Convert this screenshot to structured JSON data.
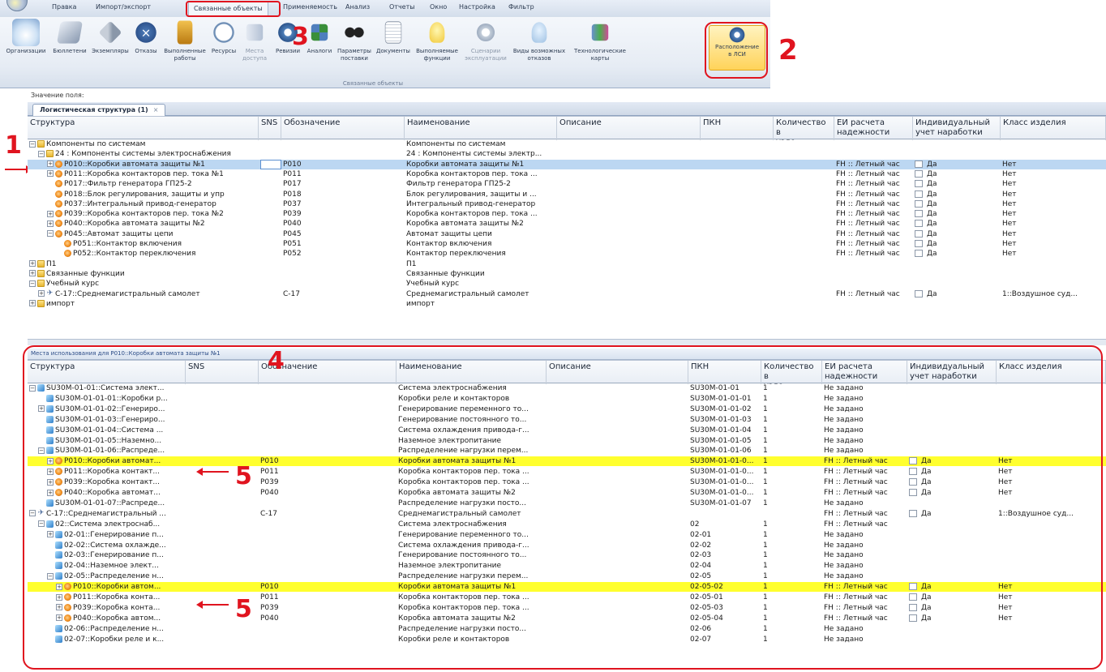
{
  "menu": {
    "tabs": [
      "Правка",
      "Импорт/экспорт",
      "Связанные объекты",
      "Применяемость",
      "Анализ",
      "Отчеты",
      "Окно",
      "Настройка",
      "Фильтр"
    ],
    "active_tab": "Связанные объекты"
  },
  "ribbon": {
    "buttons": [
      {
        "label": "Организации",
        "icon": "house-icon"
      },
      {
        "label": "Бюллетени",
        "icon": "bulletin-icon"
      },
      {
        "label": "Экземпляры",
        "icon": "wrench-icon"
      },
      {
        "label": "Отказы",
        "icon": "failure-icon"
      },
      {
        "label": "Выполненные\nработы",
        "icon": "tool-icon"
      },
      {
        "label": "Ресурсы",
        "icon": "clock-icon"
      },
      {
        "label": "Места\nдоступа",
        "icon": "access-icon"
      },
      {
        "label": "Ревизии",
        "icon": "gear-icon"
      },
      {
        "label": "Аналоги",
        "icon": "analog-icon"
      },
      {
        "label": "Параметры\nпоставки",
        "icon": "parameters-icon"
      },
      {
        "label": "Документы",
        "icon": "document-icon"
      },
      {
        "label": "Выполняемые\nфункции",
        "icon": "bulb-icon"
      },
      {
        "label": "Сценарии\nэксплуатации",
        "icon": "scenario-icon"
      },
      {
        "label": "Виды возможных\nотказов",
        "icon": "failure-kind-icon"
      },
      {
        "label": "Технологические\nкарты",
        "icon": "tech-card-icon"
      },
      {
        "label": "Расположение\nв ЛСИ",
        "icon": "location-gear-icon"
      }
    ],
    "group_label": "Связанные объекты"
  },
  "callouts": [
    "1",
    "2",
    "3",
    "4",
    "5",
    "5"
  ],
  "field_bar": "Значение поля:",
  "doc_tab": {
    "label": "Логистическая структура (1)",
    "close": "×"
  },
  "upper_grid": {
    "headers": [
      "Структура",
      "SNS",
      "Обозначение",
      "Наименование",
      "Описание",
      "ПКН",
      "Количество в\nузле",
      "ЕИ расчета\nнадежности",
      "Индивидуальный\nучет наработки",
      "Класс изделия"
    ],
    "rows": [
      {
        "level": 0,
        "exp": "−",
        "icon": "folder",
        "structure": "Компоненты по системам",
        "sns": "",
        "code": "",
        "name": "Компоненты по системам",
        "desc": "",
        "pkn": "",
        "qty": "",
        "ei": "",
        "ind": "",
        "cls": ""
      },
      {
        "level": 1,
        "exp": "−",
        "icon": "folder",
        "structure": "24 : Компоненты системы электроснабжения",
        "sns": "",
        "code": "",
        "name": "24 : Компоненты системы электр...",
        "desc": "",
        "pkn": "",
        "qty": "",
        "ei": "",
        "ind": "",
        "cls": ""
      },
      {
        "level": 2,
        "exp": "+",
        "icon": "comp",
        "structure": "P010::Коробки автомата защиты №1",
        "sns": "",
        "code": "P010",
        "name": "Коробки автомата защиты №1",
        "desc": "",
        "pkn": "",
        "qty": "",
        "ei": "FH :: Летный час",
        "ind": "Да",
        "cls": "Нет",
        "state": "selected"
      },
      {
        "level": 2,
        "exp": "+",
        "icon": "comp",
        "structure": "P011::Коробка контакторов пер. тока №1",
        "sns": "",
        "code": "P011",
        "name": "Коробка контакторов пер. тока ...",
        "desc": "",
        "pkn": "",
        "qty": "",
        "ei": "FH :: Летный час",
        "ind": "Да",
        "cls": "Нет"
      },
      {
        "level": 2,
        "exp": "",
        "icon": "comp",
        "structure": "P017::Фильтр генератора ГП25-2",
        "sns": "",
        "code": "P017",
        "name": "Фильтр генератора ГП25-2",
        "desc": "",
        "pkn": "",
        "qty": "",
        "ei": "FH :: Летный час",
        "ind": "Да",
        "cls": "Нет"
      },
      {
        "level": 2,
        "exp": "",
        "icon": "comp",
        "structure": "P018::Блок регулирования, защиты и упр",
        "sns": "",
        "code": "P018",
        "name": "Блок регулирования, защиты и ...",
        "desc": "",
        "pkn": "",
        "qty": "",
        "ei": "FH :: Летный час",
        "ind": "Да",
        "cls": "Нет"
      },
      {
        "level": 2,
        "exp": "",
        "icon": "comp",
        "structure": "P037::Интегральный привод-генератор",
        "sns": "",
        "code": "P037",
        "name": "Интегральный привод-генератор",
        "desc": "",
        "pkn": "",
        "qty": "",
        "ei": "FH :: Летный час",
        "ind": "Да",
        "cls": "Нет"
      },
      {
        "level": 2,
        "exp": "+",
        "icon": "comp",
        "structure": "P039::Коробка контакторов пер. тока №2",
        "sns": "",
        "code": "P039",
        "name": "Коробка контакторов пер. тока ...",
        "desc": "",
        "pkn": "",
        "qty": "",
        "ei": "FH :: Летный час",
        "ind": "Да",
        "cls": "Нет"
      },
      {
        "level": 2,
        "exp": "+",
        "icon": "comp",
        "structure": "P040::Коробка автомата защиты №2",
        "sns": "",
        "code": "P040",
        "name": "Коробка автомата защиты №2",
        "desc": "",
        "pkn": "",
        "qty": "",
        "ei": "FH :: Летный час",
        "ind": "Да",
        "cls": "Нет"
      },
      {
        "level": 2,
        "exp": "−",
        "icon": "comp",
        "structure": "P045::Автомат защиты цепи",
        "sns": "",
        "code": "P045",
        "name": "Автомат защиты цепи",
        "desc": "",
        "pkn": "",
        "qty": "",
        "ei": "FH :: Летный час",
        "ind": "Да",
        "cls": "Нет"
      },
      {
        "level": 3,
        "exp": "",
        "icon": "comp",
        "structure": "P051::Контактор включения",
        "sns": "",
        "code": "P051",
        "name": "Контактор включения",
        "desc": "",
        "pkn": "",
        "qty": "",
        "ei": "FH :: Летный час",
        "ind": "Да",
        "cls": "Нет"
      },
      {
        "level": 3,
        "exp": "",
        "icon": "comp",
        "structure": "P052::Контактор переключения",
        "sns": "",
        "code": "P052",
        "name": "Контактор переключения",
        "desc": "",
        "pkn": "",
        "qty": "",
        "ei": "FH :: Летный час",
        "ind": "Да",
        "cls": "Нет"
      },
      {
        "level": 0,
        "exp": "+",
        "icon": "folder",
        "structure": "П1",
        "sns": "",
        "code": "",
        "name": "П1",
        "desc": "",
        "pkn": "",
        "qty": "",
        "ei": "",
        "ind": "",
        "cls": ""
      },
      {
        "level": 0,
        "exp": "+",
        "icon": "folder",
        "structure": "Связанные функции",
        "sns": "",
        "code": "",
        "name": "Связанные функции",
        "desc": "",
        "pkn": "",
        "qty": "",
        "ei": "",
        "ind": "",
        "cls": ""
      },
      {
        "level": 0,
        "exp": "−",
        "icon": "folder",
        "structure": "Учебный курс",
        "sns": "",
        "code": "",
        "name": "Учебный курс",
        "desc": "",
        "pkn": "",
        "qty": "",
        "ei": "",
        "ind": "",
        "cls": ""
      },
      {
        "level": 1,
        "exp": "+",
        "icon": "plane",
        "structure": "С-17::Среднемагистральный самолет",
        "sns": "",
        "code": "С-17",
        "name": "Среднемагистральный самолет",
        "desc": "",
        "pkn": "",
        "qty": "",
        "ei": "FH :: Летный час",
        "ind": "Да",
        "cls": "1::Воздушное суд..."
      },
      {
        "level": 0,
        "exp": "+",
        "icon": "folder",
        "structure": "импорт",
        "sns": "",
        "code": "",
        "name": "импорт",
        "desc": "",
        "pkn": "",
        "qty": "",
        "ei": "",
        "ind": "",
        "cls": ""
      }
    ]
  },
  "lower_panel": {
    "title": "Места использования для P010::Коробки автомата защиты №1"
  },
  "lower_grid": {
    "headers": [
      "Структура",
      "SNS",
      "Обозначение",
      "Наименование",
      "Описание",
      "ПКН",
      "Количество в\nузле",
      "ЕИ расчета\nнадежности",
      "Индивидуальный\nучет наработки",
      "Класс изделия"
    ],
    "rows": [
      {
        "level": 0,
        "exp": "−",
        "icon": "node",
        "structure": "SU30M-01-01::Система элект...",
        "sns": "",
        "code": "",
        "name": "Система электроснабжения",
        "desc": "",
        "pkn": "SU30M-01-01",
        "qty": "1",
        "ei": "Не задано",
        "ind": "",
        "cls": ""
      },
      {
        "level": 1,
        "exp": "",
        "icon": "node",
        "structure": "SU30M-01-01-01::Коробки р...",
        "sns": "",
        "code": "",
        "name": "Коробки реле и контакторов",
        "desc": "",
        "pkn": "SU30M-01-01-01",
        "qty": "1",
        "ei": "Не задано",
        "ind": "",
        "cls": ""
      },
      {
        "level": 1,
        "exp": "+",
        "icon": "node",
        "structure": "SU30M-01-01-02::Генериро...",
        "sns": "",
        "code": "",
        "name": "Генерирование переменного то...",
        "desc": "",
        "pkn": "SU30M-01-01-02",
        "qty": "1",
        "ei": "Не задано",
        "ind": "",
        "cls": ""
      },
      {
        "level": 1,
        "exp": "",
        "icon": "node",
        "structure": "SU30M-01-01-03::Генериро...",
        "sns": "",
        "code": "",
        "name": "Генерирование постоянного то...",
        "desc": "",
        "pkn": "SU30M-01-01-03",
        "qty": "1",
        "ei": "Не задано",
        "ind": "",
        "cls": ""
      },
      {
        "level": 1,
        "exp": "",
        "icon": "node",
        "structure": "SU30M-01-01-04::Система ...",
        "sns": "",
        "code": "",
        "name": "Система охлаждения привода-г...",
        "desc": "",
        "pkn": "SU30M-01-01-04",
        "qty": "1",
        "ei": "Не задано",
        "ind": "",
        "cls": ""
      },
      {
        "level": 1,
        "exp": "",
        "icon": "node",
        "structure": "SU30M-01-01-05::Наземно...",
        "sns": "",
        "code": "",
        "name": "Наземное электропитание",
        "desc": "",
        "pkn": "SU30M-01-01-05",
        "qty": "1",
        "ei": "Не задано",
        "ind": "",
        "cls": ""
      },
      {
        "level": 1,
        "exp": "−",
        "icon": "node",
        "structure": "SU30M-01-01-06::Распреде...",
        "sns": "",
        "code": "",
        "name": "Распределение нагрузки перем...",
        "desc": "",
        "pkn": "SU30M-01-01-06",
        "qty": "1",
        "ei": "Не задано",
        "ind": "",
        "cls": ""
      },
      {
        "level": 2,
        "exp": "+",
        "icon": "comp",
        "structure": "P010::Коробки автомат...",
        "sns": "",
        "code": "P010",
        "name": "Коробки автомата защиты №1",
        "desc": "",
        "pkn": "SU30M-01-01-0...",
        "qty": "1",
        "ei": "FH :: Летный час",
        "ind": "Да",
        "cls": "Нет",
        "state": "hl"
      },
      {
        "level": 2,
        "exp": "+",
        "icon": "comp",
        "structure": "P011::Коробка контакт...",
        "sns": "",
        "code": "P011",
        "name": "Коробка контакторов пер. тока ...",
        "desc": "",
        "pkn": "SU30M-01-01-0...",
        "qty": "1",
        "ei": "FH :: Летный час",
        "ind": "Да",
        "cls": "Нет"
      },
      {
        "level": 2,
        "exp": "+",
        "icon": "comp",
        "structure": "P039::Коробка контакт...",
        "sns": "",
        "code": "P039",
        "name": "Коробка контакторов пер. тока ...",
        "desc": "",
        "pkn": "SU30M-01-01-0...",
        "qty": "1",
        "ei": "FH :: Летный час",
        "ind": "Да",
        "cls": "Нет"
      },
      {
        "level": 2,
        "exp": "+",
        "icon": "comp",
        "structure": "P040::Коробка автомат...",
        "sns": "",
        "code": "P040",
        "name": "Коробка автомата защиты №2",
        "desc": "",
        "pkn": "SU30M-01-01-0...",
        "qty": "1",
        "ei": "FH :: Летный час",
        "ind": "Да",
        "cls": "Нет"
      },
      {
        "level": 1,
        "exp": "",
        "icon": "node",
        "structure": "SU30M-01-01-07::Распреде...",
        "sns": "",
        "code": "",
        "name": "Распределение нагрузки посто...",
        "desc": "",
        "pkn": "SU30M-01-01-07",
        "qty": "1",
        "ei": "Не задано",
        "ind": "",
        "cls": ""
      },
      {
        "level": 0,
        "exp": "−",
        "icon": "plane",
        "structure": "С-17::Среднемагистральный ...",
        "sns": "",
        "code": "С-17",
        "name": "Среднемагистральный самолет",
        "desc": "",
        "pkn": "",
        "qty": "",
        "ei": "FH :: Летный час",
        "ind": "Да",
        "cls": "1::Воздушное суд..."
      },
      {
        "level": 1,
        "exp": "−",
        "icon": "node",
        "structure": "02::Система электроснаб...",
        "sns": "",
        "code": "",
        "name": "Система электроснабжения",
        "desc": "",
        "pkn": "02",
        "qty": "1",
        "ei": "FH :: Летный час",
        "ind": "",
        "cls": ""
      },
      {
        "level": 2,
        "exp": "+",
        "icon": "node",
        "structure": "02-01::Генерирование п...",
        "sns": "",
        "code": "",
        "name": "Генерирование переменного то...",
        "desc": "",
        "pkn": "02-01",
        "qty": "1",
        "ei": "Не задано",
        "ind": "",
        "cls": ""
      },
      {
        "level": 2,
        "exp": "",
        "icon": "node",
        "structure": "02-02::Система охлажде...",
        "sns": "",
        "code": "",
        "name": "Система охлаждения привода-г...",
        "desc": "",
        "pkn": "02-02",
        "qty": "1",
        "ei": "Не задано",
        "ind": "",
        "cls": ""
      },
      {
        "level": 2,
        "exp": "",
        "icon": "node",
        "structure": "02-03::Генерирование п...",
        "sns": "",
        "code": "",
        "name": "Генерирование постоянного то...",
        "desc": "",
        "pkn": "02-03",
        "qty": "1",
        "ei": "Не задано",
        "ind": "",
        "cls": ""
      },
      {
        "level": 2,
        "exp": "",
        "icon": "node",
        "structure": "02-04::Наземное элект...",
        "sns": "",
        "code": "",
        "name": "Наземное электропитание",
        "desc": "",
        "pkn": "02-04",
        "qty": "1",
        "ei": "Не задано",
        "ind": "",
        "cls": ""
      },
      {
        "level": 2,
        "exp": "−",
        "icon": "node",
        "structure": "02-05::Распределение н...",
        "sns": "",
        "code": "",
        "name": "Распределение нагрузки перем...",
        "desc": "",
        "pkn": "02-05",
        "qty": "1",
        "ei": "Не задано",
        "ind": "",
        "cls": ""
      },
      {
        "level": 3,
        "exp": "+",
        "icon": "comp",
        "structure": "P010::Коробки автом...",
        "sns": "",
        "code": "P010",
        "name": "Коробки автомата защиты №1",
        "desc": "",
        "pkn": "02-05-02",
        "qty": "1",
        "ei": "FH :: Летный час",
        "ind": "Да",
        "cls": "Нет",
        "state": "hl"
      },
      {
        "level": 3,
        "exp": "+",
        "icon": "comp",
        "structure": "P011::Коробка конта...",
        "sns": "",
        "code": "P011",
        "name": "Коробка контакторов пер. тока ...",
        "desc": "",
        "pkn": "02-05-01",
        "qty": "1",
        "ei": "FH :: Летный час",
        "ind": "Да",
        "cls": "Нет"
      },
      {
        "level": 3,
        "exp": "+",
        "icon": "comp",
        "structure": "P039::Коробка конта...",
        "sns": "",
        "code": "P039",
        "name": "Коробка контакторов пер. тока ...",
        "desc": "",
        "pkn": "02-05-03",
        "qty": "1",
        "ei": "FH :: Летный час",
        "ind": "Да",
        "cls": "Нет"
      },
      {
        "level": 3,
        "exp": "+",
        "icon": "comp",
        "structure": "P040::Коробка автом...",
        "sns": "",
        "code": "P040",
        "name": "Коробка автомата защиты №2",
        "desc": "",
        "pkn": "02-05-04",
        "qty": "1",
        "ei": "FH :: Летный час",
        "ind": "Да",
        "cls": "Нет"
      },
      {
        "level": 2,
        "exp": "",
        "icon": "node",
        "structure": "02-06::Распределение н...",
        "sns": "",
        "code": "",
        "name": "Распределение нагрузки посто...",
        "desc": "",
        "pkn": "02-06",
        "qty": "1",
        "ei": "Не задано",
        "ind": "",
        "cls": ""
      },
      {
        "level": 2,
        "exp": "",
        "icon": "node",
        "structure": "02-07::Коробки реле и к...",
        "sns": "",
        "code": "",
        "name": "Коробки реле и контакторов",
        "desc": "",
        "pkn": "02-07",
        "qty": "1",
        "ei": "Не задано",
        "ind": "",
        "cls": ""
      }
    ]
  }
}
